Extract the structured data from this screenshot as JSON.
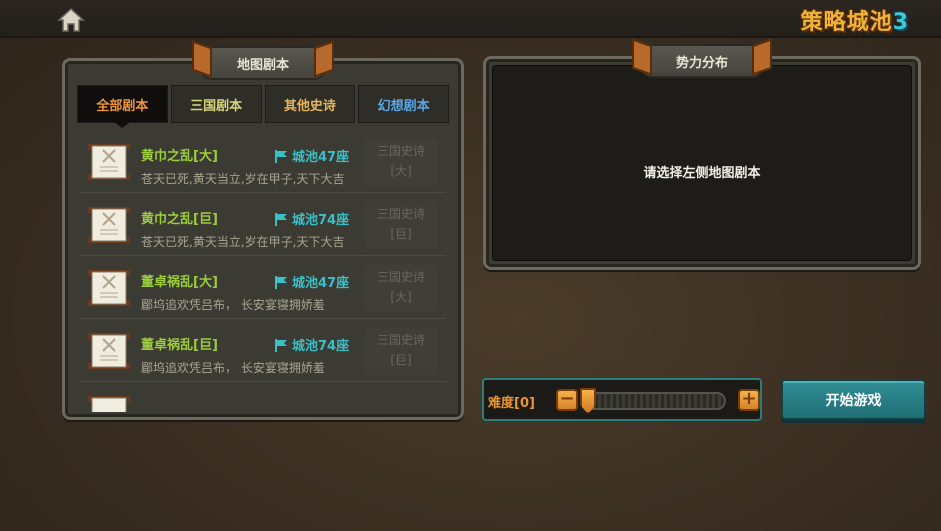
{
  "header": {
    "logo_main": "策略城池",
    "logo_num": "3"
  },
  "map_panel": {
    "title": "地图剧本",
    "tabs": [
      {
        "label": "全部剧本",
        "active": true
      },
      {
        "label": "三国剧本",
        "active": false
      },
      {
        "label": "其他史诗",
        "active": false
      },
      {
        "label": "幻想剧本",
        "active": false
      }
    ],
    "scenarios": [
      {
        "title": "黄巾之乱[大]",
        "cities": "城池47座",
        "desc": "苍天已死,黄天当立,岁在甲子,天下大吉",
        "tag_line1": "三国史诗",
        "tag_line2": "[大]"
      },
      {
        "title": "黄巾之乱[巨]",
        "cities": "城池74座",
        "desc": "苍天已死,黄天当立,岁在甲子,天下大吉",
        "tag_line1": "三国史诗",
        "tag_line2": "[巨]"
      },
      {
        "title": "董卓祸乱[大]",
        "cities": "城池47座",
        "desc": "郿坞追欢凭吕布， 长安宴寝拥娇羞",
        "tag_line1": "三国史诗",
        "tag_line2": "[大]"
      },
      {
        "title": "董卓祸乱[巨]",
        "cities": "城池74座",
        "desc": "郿坞追欢凭吕布， 长安宴寝拥娇羞",
        "tag_line1": "三国史诗",
        "tag_line2": "[巨]"
      }
    ]
  },
  "faction_panel": {
    "title": "势力分布",
    "hint": "请选择左侧地图剧本"
  },
  "difficulty": {
    "label": "难度[0]",
    "value": 0,
    "minus": "−",
    "plus": "+"
  },
  "start_button": "开始游戏",
  "colors": {
    "accent_orange": "#e99733",
    "teal": "#2f8e94",
    "title_green": "#9bce3c",
    "city_cyan": "#3bbfc6"
  }
}
